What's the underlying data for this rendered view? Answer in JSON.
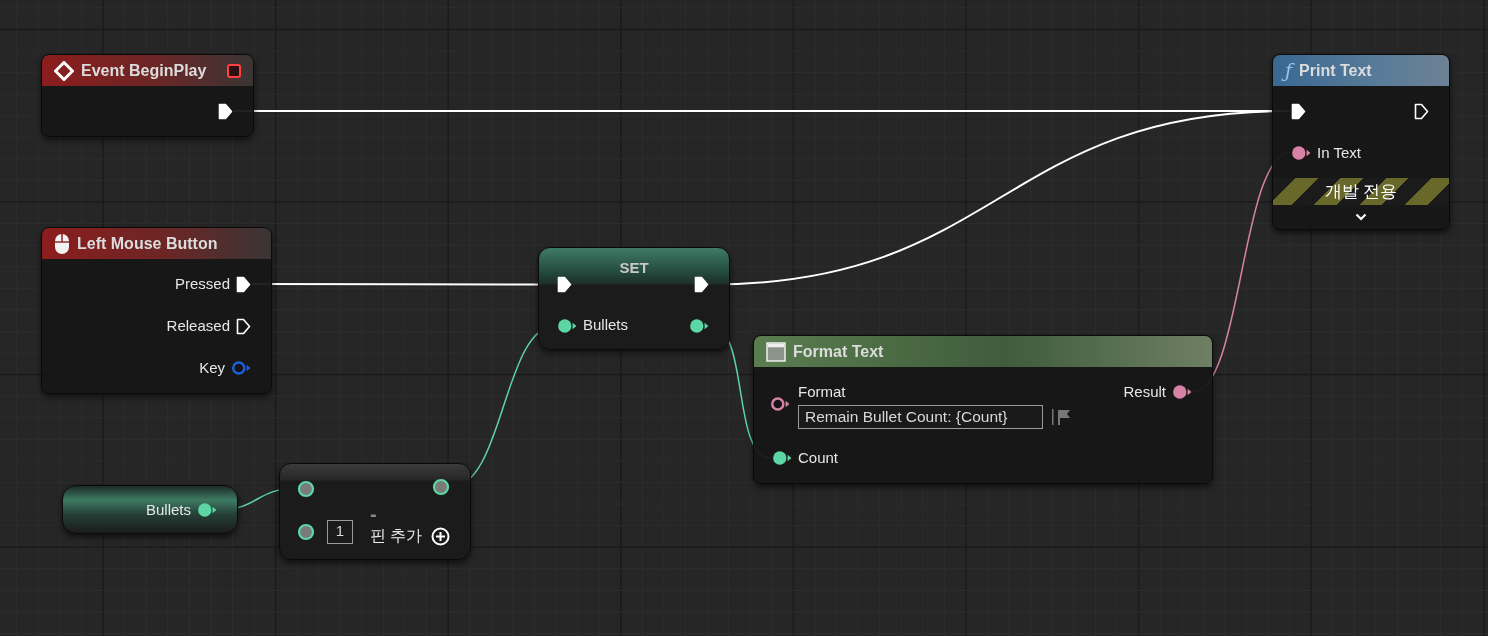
{
  "nodes": [
    {
      "kind": "event",
      "title": "Event BeginPlay",
      "outputs": [
        {
          "kind": "exec",
          "connected": true
        }
      ]
    },
    {
      "kind": "input",
      "title": "Left Mouse Button",
      "outputs": [
        {
          "kind": "exec",
          "label": "Pressed",
          "connected": true
        },
        {
          "kind": "exec",
          "label": "Released",
          "connected": false
        },
        {
          "kind": "key",
          "label": "Key",
          "connected": false
        }
      ]
    },
    {
      "kind": "set",
      "title": "SET",
      "inputs": [
        {
          "kind": "exec",
          "connected": true
        },
        {
          "kind": "int",
          "label": "Bullets",
          "connected": true
        }
      ],
      "outputs": [
        {
          "kind": "exec",
          "connected": true
        },
        {
          "kind": "int",
          "connected": true
        }
      ]
    },
    {
      "kind": "function",
      "title": "Print Text",
      "icon_glyph": "ƒ",
      "inputs": [
        {
          "kind": "exec",
          "connected": true
        },
        {
          "kind": "text",
          "label": "In Text",
          "connected": true
        }
      ],
      "outputs": [
        {
          "kind": "exec",
          "connected": false
        }
      ],
      "banner": "개발 전용"
    },
    {
      "kind": "format",
      "title": "Format Text",
      "inputs": [
        {
          "kind": "text",
          "label": "Format",
          "value": "Remain Bullet Count: {Count}",
          "connected": false
        },
        {
          "kind": "int",
          "label": "Count",
          "connected": true
        }
      ],
      "outputs": [
        {
          "kind": "text",
          "label": "Result",
          "connected": true
        }
      ]
    },
    {
      "kind": "variable",
      "outputs": [
        {
          "kind": "int",
          "label": "Bullets",
          "connected": true
        }
      ]
    },
    {
      "kind": "math",
      "operator": "-",
      "inputs": [
        {
          "kind": "number"
        },
        {
          "kind": "number",
          "value": "1"
        }
      ],
      "outputs": [
        {
          "kind": "number"
        }
      ],
      "add_pin": "핀 추가"
    }
  ]
}
